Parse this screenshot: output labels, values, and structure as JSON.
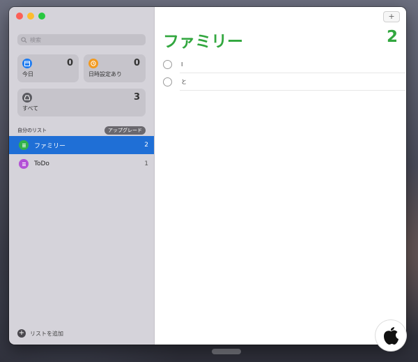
{
  "sidebar": {
    "search_placeholder": "検索",
    "smart_lists": [
      {
        "label": "今日",
        "count": "0",
        "icon": "calendar-icon",
        "color": "#1f7cf0"
      },
      {
        "label": "日時設定あり",
        "count": "0",
        "icon": "clock-icon",
        "color": "#f29a20"
      },
      {
        "label": "すべて",
        "count": "3",
        "icon": "tray-icon",
        "color": "#5a5a60"
      }
    ],
    "section_title": "自分のリスト",
    "upgrade_label": "アップグレード",
    "lists": [
      {
        "name": "ファミリー",
        "count": "2",
        "icon": "list-icon",
        "color": "#32b34a",
        "selected": true
      },
      {
        "name": "ToDo",
        "count": "1",
        "icon": "list-icon",
        "color": "#b351d6",
        "selected": false
      }
    ],
    "add_list_label": "リストを追加"
  },
  "main": {
    "title": "ファミリー",
    "count": "2",
    "accent_color": "#32a73f",
    "tasks": [
      {
        "text": "I"
      },
      {
        "text": "と"
      }
    ]
  }
}
